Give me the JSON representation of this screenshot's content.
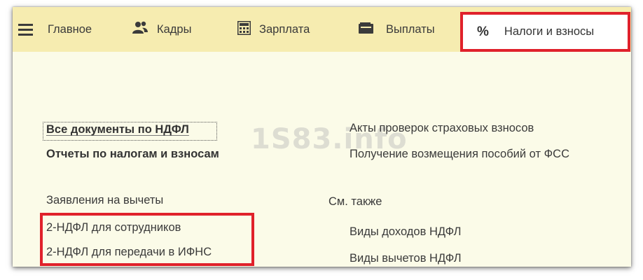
{
  "nav": {
    "menu_icon": "hamburger-icon",
    "sections": [
      {
        "label": "Главное",
        "icon": "none"
      },
      {
        "label": "Кадры",
        "icon": "people-icon"
      },
      {
        "label": "Зарплата",
        "icon": "calculator-icon"
      },
      {
        "label": "Выплаты",
        "icon": "wallet-icon"
      }
    ],
    "active": {
      "label": "Налоги и взносы",
      "icon_glyph": "%",
      "icon": "percent-icon"
    }
  },
  "left_column": {
    "all_docs": "Все документы по НДФЛ",
    "reports": "Отчеты по налогам и взносам",
    "deductions": "Заявления на вычеты",
    "ndfl_employees": "2-НДФЛ для сотрудников",
    "ndfl_ifns": "2-НДФЛ для передачи в ИФНС"
  },
  "right_column": {
    "acts": "Акты проверок страховых взносов",
    "reimbursement": "Получение возмещения пособий от ФСС",
    "see_also": "См. также",
    "income_types": "Виды доходов НДФЛ",
    "deduction_types": "Виды вычетов НДФЛ"
  },
  "watermark": "1S83.info",
  "colors": {
    "topbar": "#f6ecb0",
    "content_bg": "#fbfbe8",
    "highlight": "#e0212b"
  }
}
